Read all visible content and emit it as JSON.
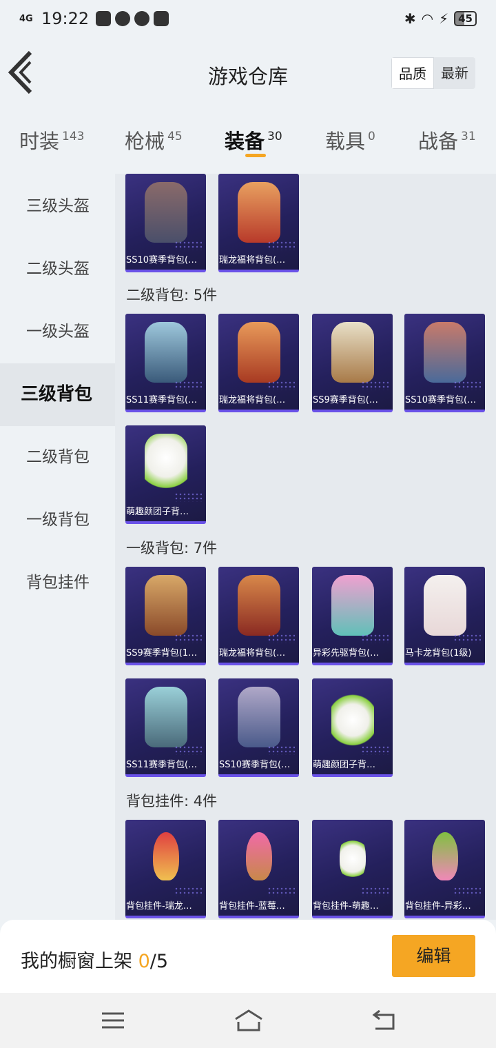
{
  "status_bar": {
    "network": "4G",
    "time": "19:22",
    "battery": "45"
  },
  "header": {
    "title": "游戏仓库",
    "sort": [
      "品质",
      "最新"
    ]
  },
  "tabs": [
    {
      "label": "时装",
      "count": "143"
    },
    {
      "label": "枪械",
      "count": "45"
    },
    {
      "label": "装备",
      "count": "30"
    },
    {
      "label": "载具",
      "count": "0"
    },
    {
      "label": "战备",
      "count": "31"
    }
  ],
  "sidebar": [
    "三级头盔",
    "二级头盔",
    "一级头盔",
    "三级背包",
    "二级背包",
    "一级背包",
    "背包挂件"
  ],
  "sections": {
    "top_row": [
      "SS10赛季背包(…",
      "瑞龙福将背包(…"
    ],
    "level2": {
      "title": "二级背包: 5件",
      "items": [
        "SS11赛季背包(…",
        "瑞龙福将背包(…",
        "SS9赛季背包(…",
        "SS10赛季背包(…",
        "萌趣颜团子背…"
      ]
    },
    "level1": {
      "title": "一级背包: 7件",
      "items": [
        "SS9赛季背包(1…",
        "瑞龙福将背包(…",
        "异彩先驱背包(…",
        "马卡龙背包(1级)",
        "SS11赛季背包(…",
        "SS10赛季背包(…",
        "萌趣颜团子背…"
      ]
    },
    "charms": {
      "title": "背包挂件: 4件",
      "items": [
        "背包挂件-瑞龙…",
        "背包挂件-蓝莓…",
        "背包挂件-萌趣…",
        "背包挂件-异彩…"
      ]
    }
  },
  "bottom": {
    "label": "我的橱窗上架 ",
    "count": "0",
    "total": "/5",
    "edit": "编辑"
  }
}
